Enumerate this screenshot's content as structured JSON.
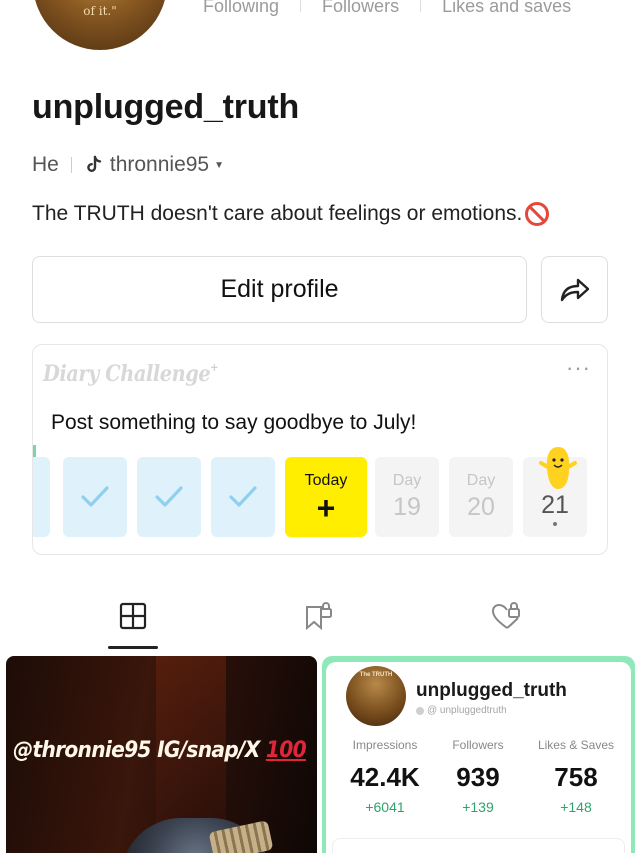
{
  "profile": {
    "avatar_text": "of it.\"",
    "stats": [
      {
        "label": "Following"
      },
      {
        "label": "Followers"
      },
      {
        "label": "Likes and saves"
      }
    ],
    "username": "unplugged_truth",
    "pronoun": "He",
    "tiktok_handle": "thronnie95",
    "bio": "The TRUTH doesn't care about feelings or emotions.",
    "bio_icon": "prohibited-icon",
    "edit_profile_label": "Edit profile",
    "share_icon": "share-arrow-icon"
  },
  "diary": {
    "logo": "Diary Challenge",
    "more_icon": "more-dots-icon",
    "prompt": "Post something to say goodbye to July!",
    "today_label": "Today",
    "today_action": "+",
    "days": [
      {
        "label": "Day",
        "number": "19"
      },
      {
        "label": "Day",
        "number": "20"
      },
      {
        "label": "",
        "number": "21"
      }
    ],
    "completed_days": 3,
    "mascot_icon": "yellow-mascot-icon"
  },
  "tabs": [
    {
      "name": "posts",
      "icon": "grid-icon",
      "selected": true
    },
    {
      "name": "saved",
      "icon": "locked-bookmark-icon",
      "selected": false
    },
    {
      "name": "liked",
      "icon": "locked-heart-icon",
      "selected": false
    }
  ],
  "posts": {
    "left": {
      "caption_main": "@thronnie95 IG/snap/X ",
      "caption_emoji": "100"
    },
    "right": {
      "avatar_text": "The TRUTH",
      "name": "unplugged_truth",
      "handle": "@ unpluggedtruth",
      "stats": [
        {
          "label": "Impressions",
          "value": "42.4K",
          "delta": "+6041"
        },
        {
          "label": "Followers",
          "value": "939",
          "delta": "+139"
        },
        {
          "label": "Likes & Saves",
          "value": "758",
          "delta": "+148"
        }
      ]
    }
  },
  "colors": {
    "today_yellow": "#ffee00",
    "done_blue": "#dff2fb",
    "check_blue": "#8fd0ee",
    "delta_green": "#2ea36a",
    "card_border_green": "#8fe8b8",
    "prohibited_red": "#e5483b"
  }
}
